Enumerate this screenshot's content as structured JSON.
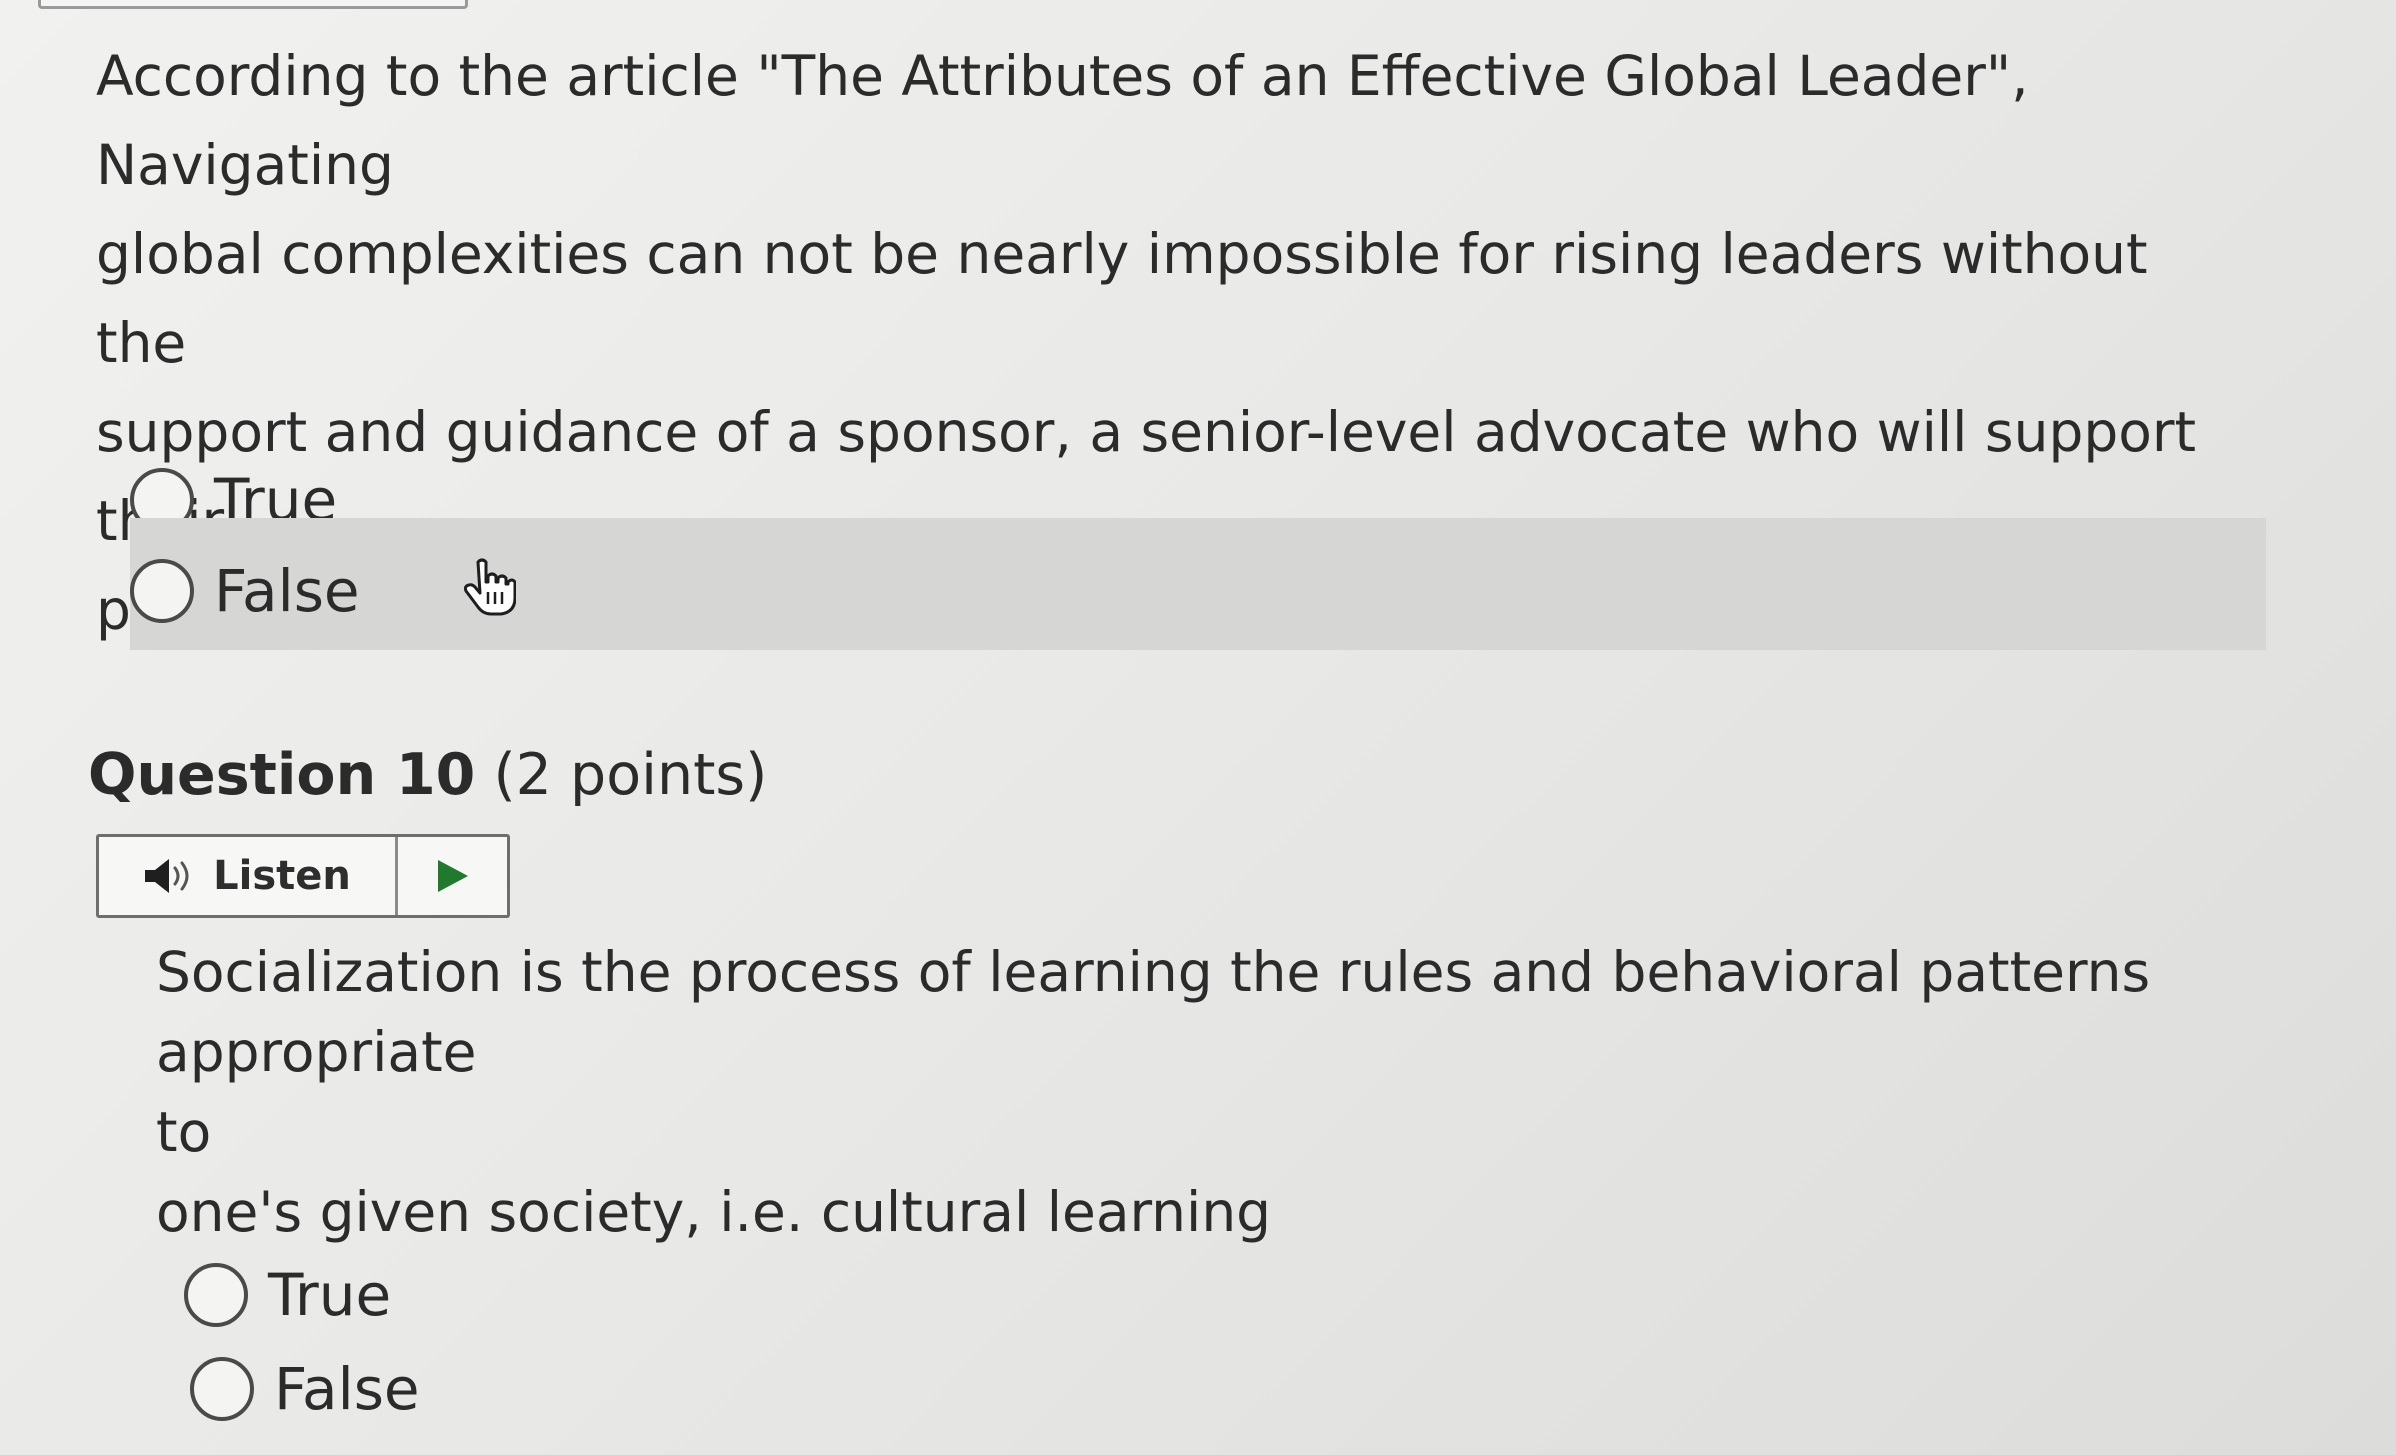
{
  "question9": {
    "prompt": "According to the article \"The Attributes of an Effective Global Leader\", Navigating\nglobal complexities can not  be nearly impossible for rising leaders without the\nsupport and guidance of a sponsor, a senior-level advocate who will support their\nprotégé’s authority and empower them to make decisions.",
    "options": [
      {
        "label": "True"
      },
      {
        "label": "False"
      }
    ]
  },
  "question10": {
    "title": "Question 10",
    "points": "(2 points)",
    "listen_label": "Listen",
    "text_line1": "Socialization is the process of learning the rules and behavioral patterns appropriate",
    "text_line2": "to",
    "text_line3": "one's given society, i.e. cultural learning",
    "options": [
      {
        "label": "True"
      },
      {
        "label": "False"
      }
    ]
  },
  "colors": {
    "hover_row": "#d6d6d4",
    "play_icon": "#1f7a2e"
  },
  "icons": {
    "cursor": "hand-pointer-icon",
    "listen": "speaker-icon",
    "play": "play-icon"
  }
}
